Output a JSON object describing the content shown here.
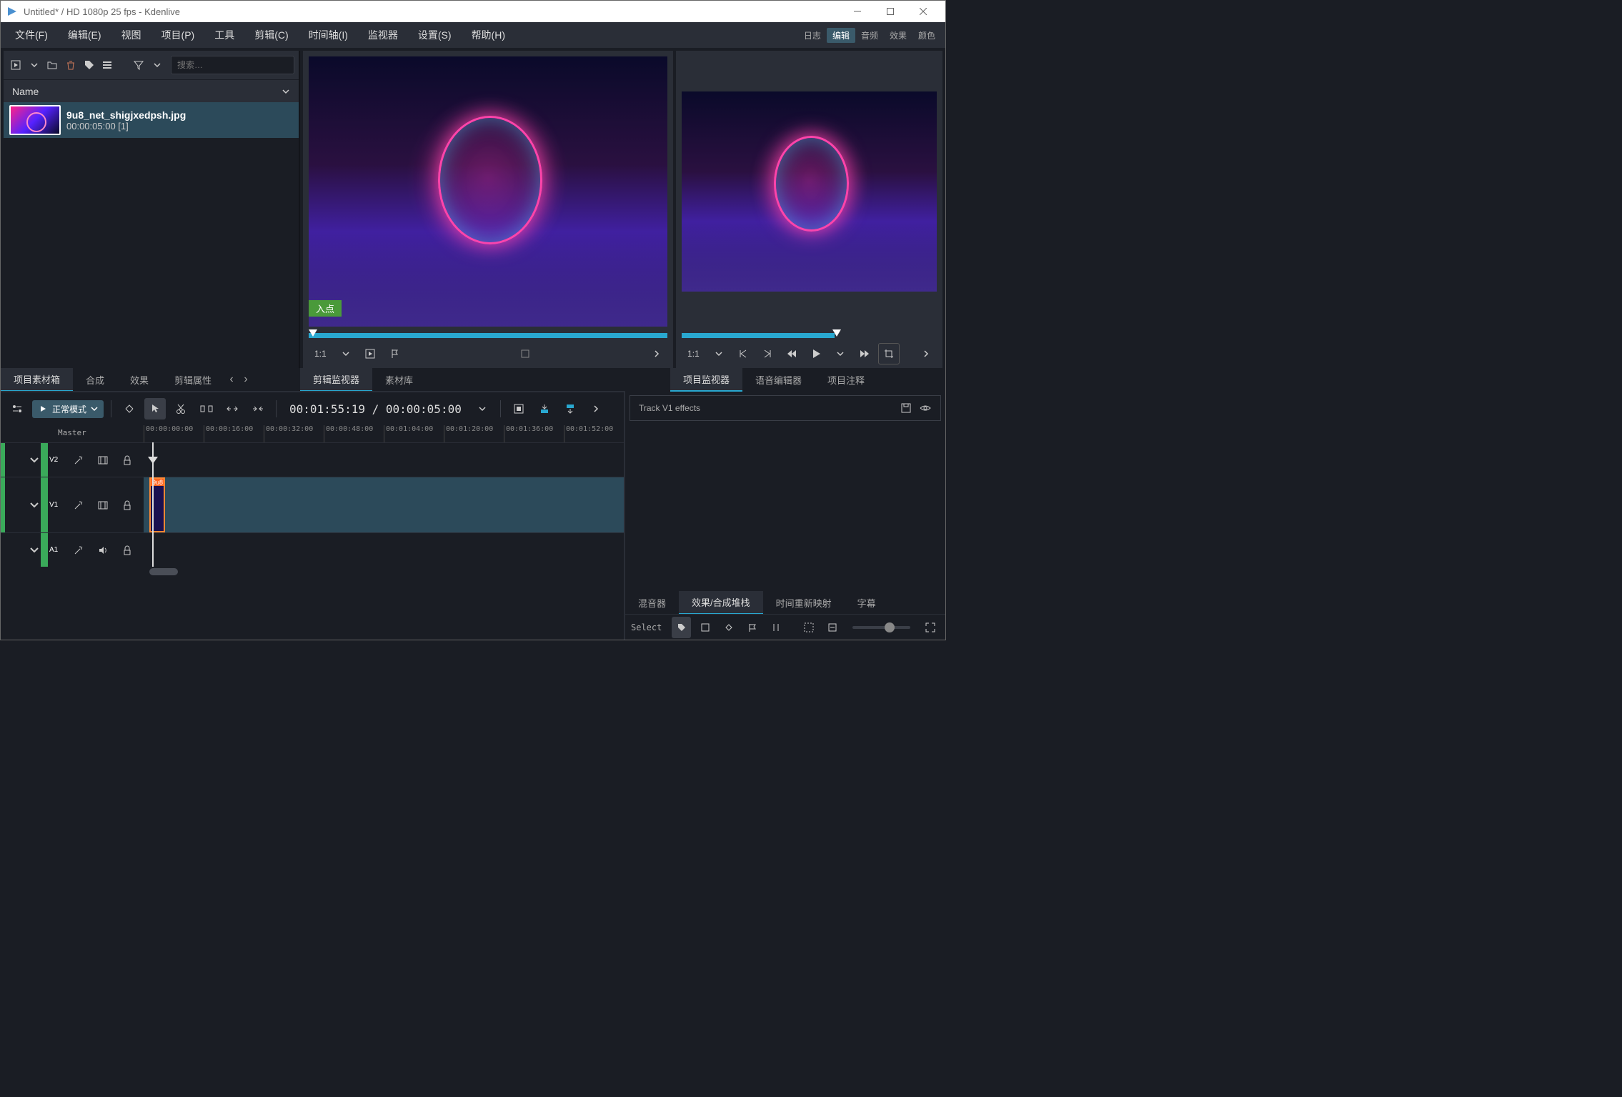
{
  "titlebar": {
    "title": "Untitled* / HD 1080p 25 fps - Kdenlive"
  },
  "menu": {
    "file": "文件(F)",
    "edit": "编辑(E)",
    "view": "视图",
    "project": "项目(P)",
    "tool": "工具",
    "clip": "剪辑(C)",
    "timeline": "时间轴(I)",
    "monitor": "监视器",
    "settings": "设置(S)",
    "help": "帮助(H)",
    "tag_log": "日志",
    "tag_edit": "编辑",
    "tag_audio": "音频",
    "tag_effect": "效果",
    "tag_color": "颜色"
  },
  "bin": {
    "search_placeholder": "搜索…",
    "header": "Name",
    "item": {
      "name": "9u8_net_shigjxedpsh.jpg",
      "meta": "00:00:05:00 [1]"
    }
  },
  "bin_tabs": {
    "project_bin": "项目素材箱",
    "compose": "合成",
    "effects": "效果",
    "clip_props": "剪辑属性"
  },
  "clip_monitor": {
    "ratio": "1:1",
    "in_label": "入点"
  },
  "clip_mon_tabs": {
    "clip_monitor": "剪辑监视器",
    "library": "素材库"
  },
  "proj_monitor": {
    "ratio": "1:1"
  },
  "proj_mon_tabs": {
    "project_monitor": "项目监视器",
    "speech": "语音编辑器",
    "notes": "项目注释"
  },
  "timeline": {
    "mode": "正常模式",
    "timecode": "00:01:55:19 / 00:00:05:00",
    "master": "Master",
    "ruler": [
      "00:00:00:00",
      "00:00:16:00",
      "00:00:32:00",
      "00:00:48:00",
      "00:01:04:00",
      "00:01:20:00",
      "00:01:36:00",
      "00:01:52:00"
    ],
    "tracks": {
      "v2": "V2",
      "v1": "V1",
      "a1": "A1"
    },
    "clip_label": "9u8"
  },
  "effects": {
    "header": "Track V1 effects",
    "tabs": {
      "mixer": "混音器",
      "stack": "效果/合成堆栈",
      "remap": "时间重新映射",
      "subtitle": "字幕"
    }
  },
  "bottom": {
    "select": "Select"
  }
}
